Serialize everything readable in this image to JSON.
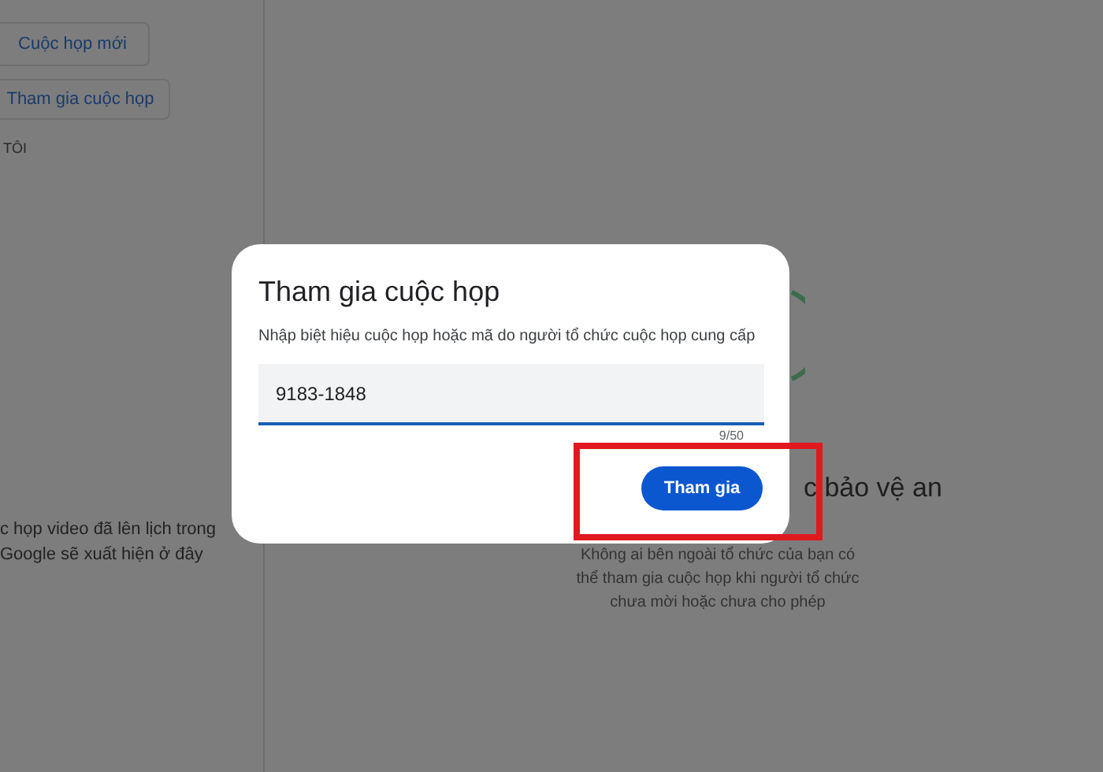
{
  "sidebar": {
    "buttons": [
      {
        "label": "Cuộc họp mới"
      },
      {
        "label": "Tham gia cuộc họp"
      }
    ],
    "section_label": "TÔI",
    "empty_text": [
      "c họp video đã lên lịch trong",
      "Google sẽ xuất hiện ở đây"
    ]
  },
  "main": {
    "title_fragment": "c bảo vệ an",
    "description": [
      "Không ai bên ngoài tổ chức của bạn có",
      "thể tham gia cuộc họp khi người tổ chức",
      "chưa mời hoặc chưa cho phép"
    ]
  },
  "dialog": {
    "title": "Tham gia cuộc họp",
    "instruction": "Nhập biệt hiệu cuộc họp hoặc mã do người tổ chức cuộc họp cung cấp",
    "field": {
      "value": "9183-1848",
      "counter": "9/50"
    },
    "button": "Tham gia"
  }
}
